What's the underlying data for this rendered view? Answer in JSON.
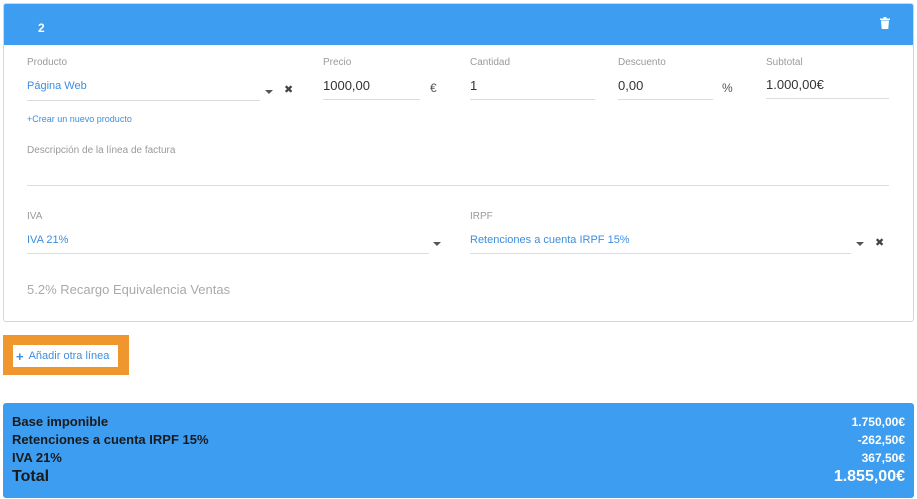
{
  "line": {
    "number": "2",
    "fields": {
      "product": {
        "label": "Producto",
        "value": "Página Web"
      },
      "price": {
        "label": "Precio",
        "value": "1000,00",
        "unit": "€"
      },
      "quantity": {
        "label": "Cantidad",
        "value": "1"
      },
      "discount": {
        "label": "Descuento",
        "value": "0,00",
        "unit": "%"
      },
      "subtotal": {
        "label": "Subtotal",
        "value": "1.000,00€"
      }
    },
    "create_product_link": "+Crear un nuevo producto",
    "description_label": "Descripción de la línea de factura",
    "iva": {
      "label": "IVA",
      "value": "IVA 21%"
    },
    "irpf": {
      "label": "IRPF",
      "value": "Retenciones a cuenta IRPF 15%"
    },
    "recargo_text": "5.2% Recargo Equivalencia Ventas"
  },
  "add_line_label": "Añadir otra línea",
  "totals": {
    "base": {
      "label": "Base imponible",
      "amount": "1.750,00€"
    },
    "retenciones": {
      "label": "Retenciones a cuenta IRPF 15%",
      "amount": "-262,50€"
    },
    "iva": {
      "label": "IVA 21%",
      "amount": "367,50€"
    },
    "total": {
      "label": "Total",
      "amount": "1.855,00€"
    }
  },
  "colors": {
    "accent": "#3d9df0",
    "link": "#3d8ee0",
    "highlight": "#f0962f"
  }
}
